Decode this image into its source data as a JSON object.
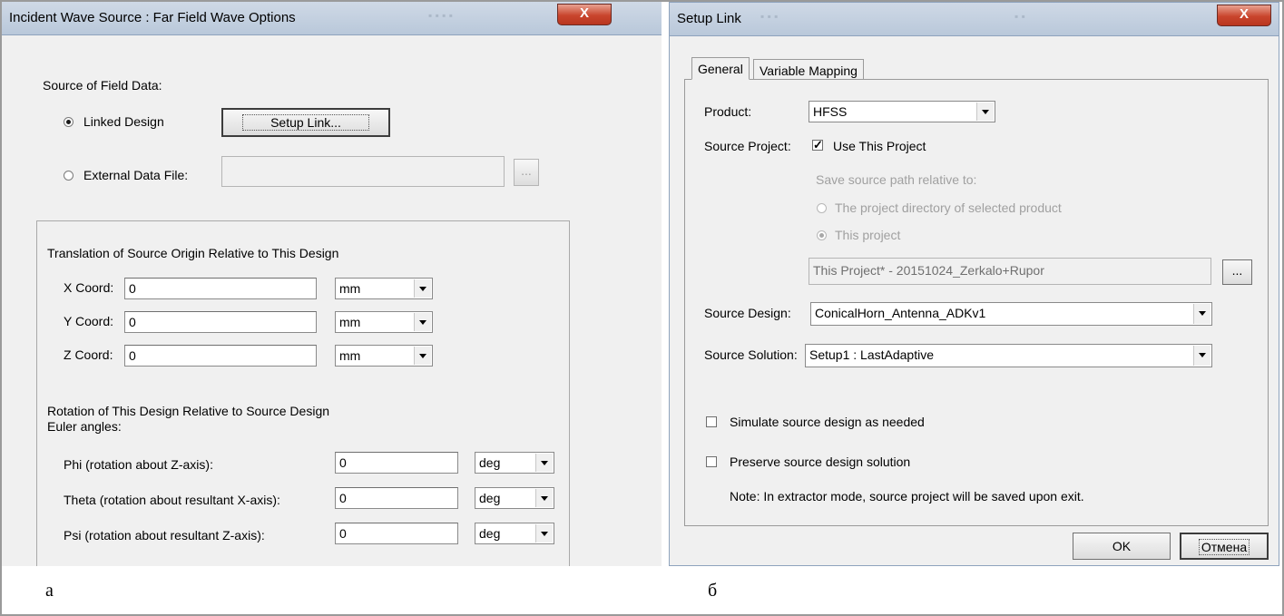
{
  "left_dialog": {
    "title": "Incident Wave Source : Far Field Wave Options",
    "close_glyph": "X",
    "source_of_field_data": "Source of Field Data:",
    "linked_design_label": "Linked Design",
    "setup_link_button": "Setup Link...",
    "external_data_file_label": "External Data File:",
    "external_data_file_value": "",
    "browse_button": "...",
    "translation_heading": "Translation of Source Origin Relative to This Design",
    "coords": [
      {
        "label": "X Coord:",
        "value": "0",
        "unit": "mm"
      },
      {
        "label": "Y Coord:",
        "value": "0",
        "unit": "mm"
      },
      {
        "label": "Z Coord:",
        "value": "0",
        "unit": "mm"
      }
    ],
    "rotation_heading": "Rotation of This Design Relative to Source Design",
    "euler_label": "Euler angles:",
    "angles": [
      {
        "label": "Phi (rotation about Z-axis):",
        "value": "0",
        "unit": "deg"
      },
      {
        "label": "Theta (rotation about resultant X-axis):",
        "value": "0",
        "unit": "deg"
      },
      {
        "label": "Psi (rotation about resultant Z-axis):",
        "value": "0",
        "unit": "deg"
      }
    ],
    "caption": "а"
  },
  "right_dialog": {
    "title": "Setup Link",
    "close_glyph": "X",
    "tabs": [
      "General",
      "Variable Mapping"
    ],
    "product_label": "Product:",
    "product_value": "HFSS",
    "source_project_label": "Source Project:",
    "use_this_project_label": "Use This Project",
    "save_relative_label": "Save source path relative to:",
    "radio_project_dir": "The project directory of selected product",
    "radio_this_project": "This project",
    "project_path_value": "This Project* - 20151024_Zerkalo+Rupor",
    "browse_button": "...",
    "source_design_label": "Source Design:",
    "source_design_value": "ConicalHorn_Antenna_ADKv1",
    "source_solution_label": "Source Solution:",
    "source_solution_value": "Setup1 : LastAdaptive",
    "simulate_label": "Simulate source design as needed",
    "preserve_label": "Preserve source design solution",
    "note": "Note: In extractor mode, source project will be saved upon exit.",
    "ok_button": "OK",
    "cancel_button": "Отмена",
    "caption": "б"
  }
}
